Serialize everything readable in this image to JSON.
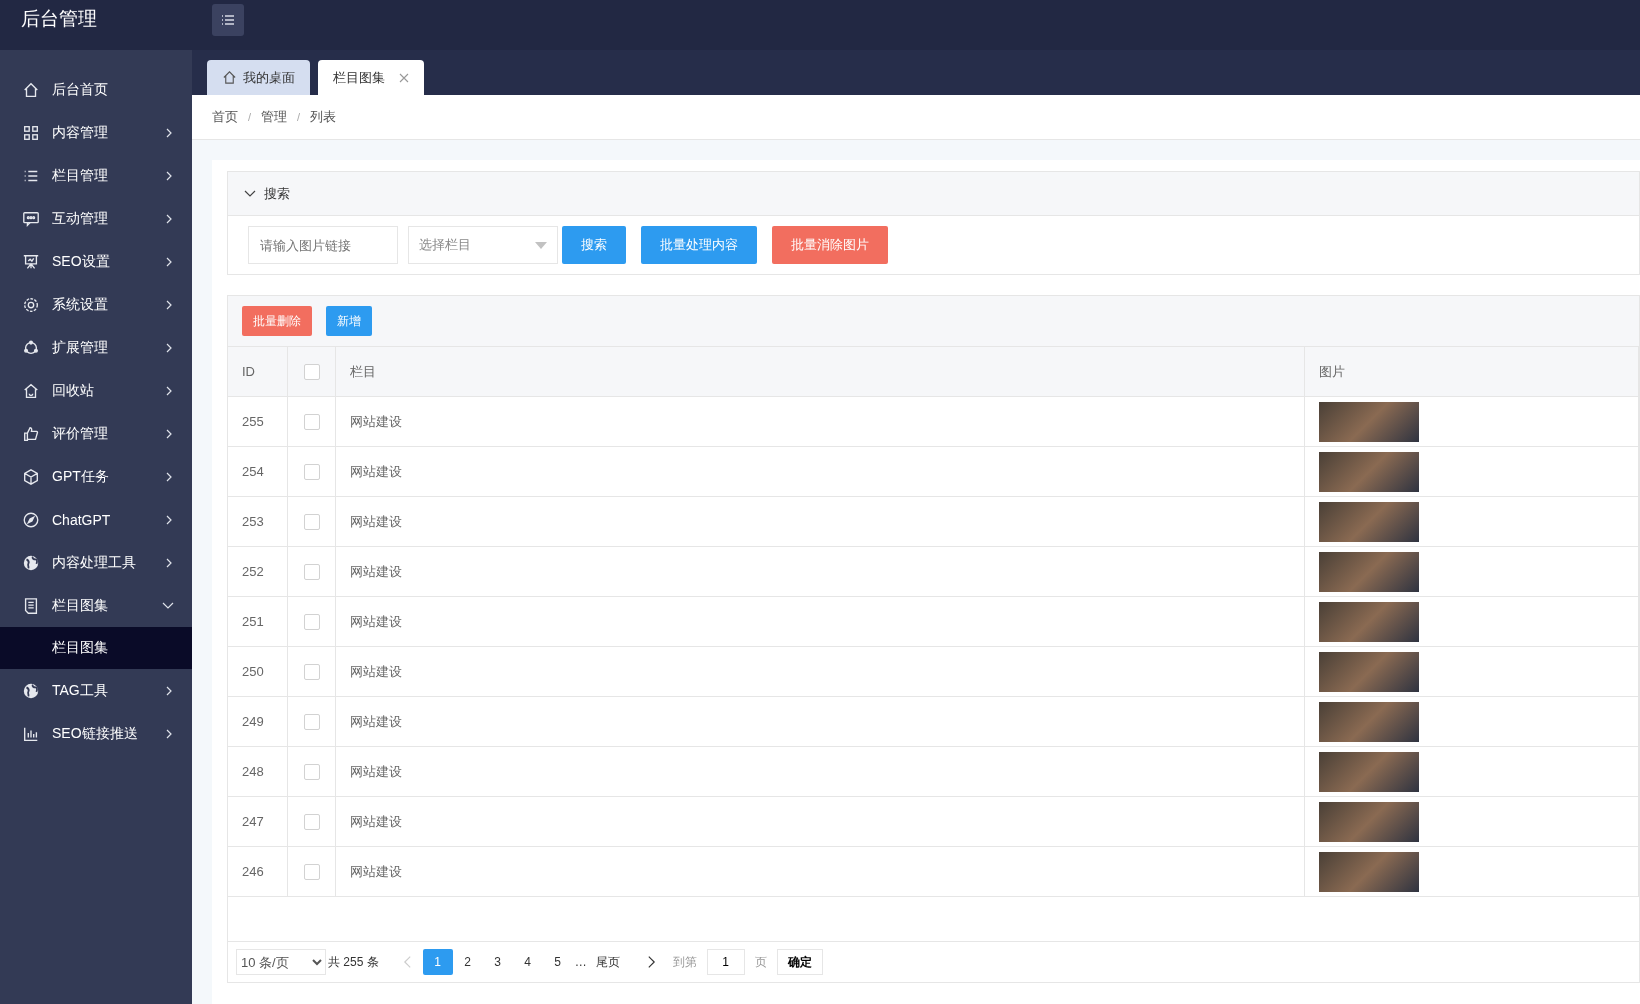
{
  "header": {
    "title": "后台管理"
  },
  "sidebar": {
    "items": [
      {
        "label": "后台首页"
      },
      {
        "label": "内容管理",
        "expanded": false
      },
      {
        "label": "栏目管理",
        "expanded": false
      },
      {
        "label": "互动管理",
        "expanded": false
      },
      {
        "label": "SEO设置",
        "expanded": false
      },
      {
        "label": "系统设置",
        "expanded": false
      },
      {
        "label": "扩展管理",
        "expanded": false
      },
      {
        "label": "回收站",
        "expanded": false
      },
      {
        "label": "评价管理",
        "expanded": false
      },
      {
        "label": "GPT任务",
        "expanded": false
      },
      {
        "label": "ChatGPT",
        "expanded": false
      },
      {
        "label": "内容处理工具",
        "expanded": false
      },
      {
        "label": "栏目图集",
        "expanded": true,
        "children": [
          {
            "label": "栏目图集",
            "selected": true
          }
        ]
      },
      {
        "label": "TAG工具",
        "expanded": false
      },
      {
        "label": "SEO链接推送",
        "expanded": false
      }
    ]
  },
  "tabs": [
    {
      "label": "我的桌面",
      "kind": "home",
      "selected": false,
      "closable": false
    },
    {
      "label": "栏目图集",
      "kind": "page",
      "selected": true,
      "closable": true
    }
  ],
  "breadcrumb": {
    "items": [
      "首页",
      "管理",
      "列表"
    ],
    "separator": "/"
  },
  "search": {
    "title": "搜索",
    "expanded": true,
    "link_field": {
      "placeholder": "请输入图片链接"
    },
    "category_select": {
      "placeholder": "选择栏目"
    },
    "buttons": [
      {
        "label": "搜索",
        "kind": "primary"
      },
      {
        "label": "批量处理内容",
        "kind": "primary"
      },
      {
        "label": "批量消除图片",
        "kind": "danger"
      }
    ]
  },
  "toolbar": {
    "buttons": [
      {
        "label": "批量删除",
        "kind": "danger"
      },
      {
        "label": "新增",
        "kind": "primary"
      }
    ]
  },
  "table": {
    "columns": [
      "ID",
      "栏目",
      "图片"
    ],
    "header_checked": false,
    "rows": [
      {
        "id": "255",
        "checked": false,
        "column": "网站建设"
      },
      {
        "id": "254",
        "checked": false,
        "column": "网站建设"
      },
      {
        "id": "253",
        "checked": false,
        "column": "网站建设"
      },
      {
        "id": "252",
        "checked": false,
        "column": "网站建设"
      },
      {
        "id": "251",
        "checked": false,
        "column": "网站建设"
      },
      {
        "id": "250",
        "checked": false,
        "column": "网站建设"
      },
      {
        "id": "249",
        "checked": false,
        "column": "网站建设"
      },
      {
        "id": "248",
        "checked": false,
        "column": "网站建设"
      },
      {
        "id": "247",
        "checked": false,
        "column": "网站建设"
      },
      {
        "id": "246",
        "checked": false,
        "column": "网站建设"
      }
    ]
  },
  "pagination": {
    "page_size": "10 条/页",
    "total": "共 255 条",
    "prev_disabled": true,
    "pages": [
      {
        "label": "1",
        "selected": true
      },
      {
        "label": "2",
        "selected": false
      },
      {
        "label": "3",
        "selected": false
      },
      {
        "label": "4",
        "selected": false
      },
      {
        "label": "5",
        "selected": false
      }
    ],
    "ellipsis": "…",
    "last": "尾页",
    "goto_label": "到第",
    "goto_value": "1",
    "page_unit": "页",
    "confirm": "确定"
  }
}
